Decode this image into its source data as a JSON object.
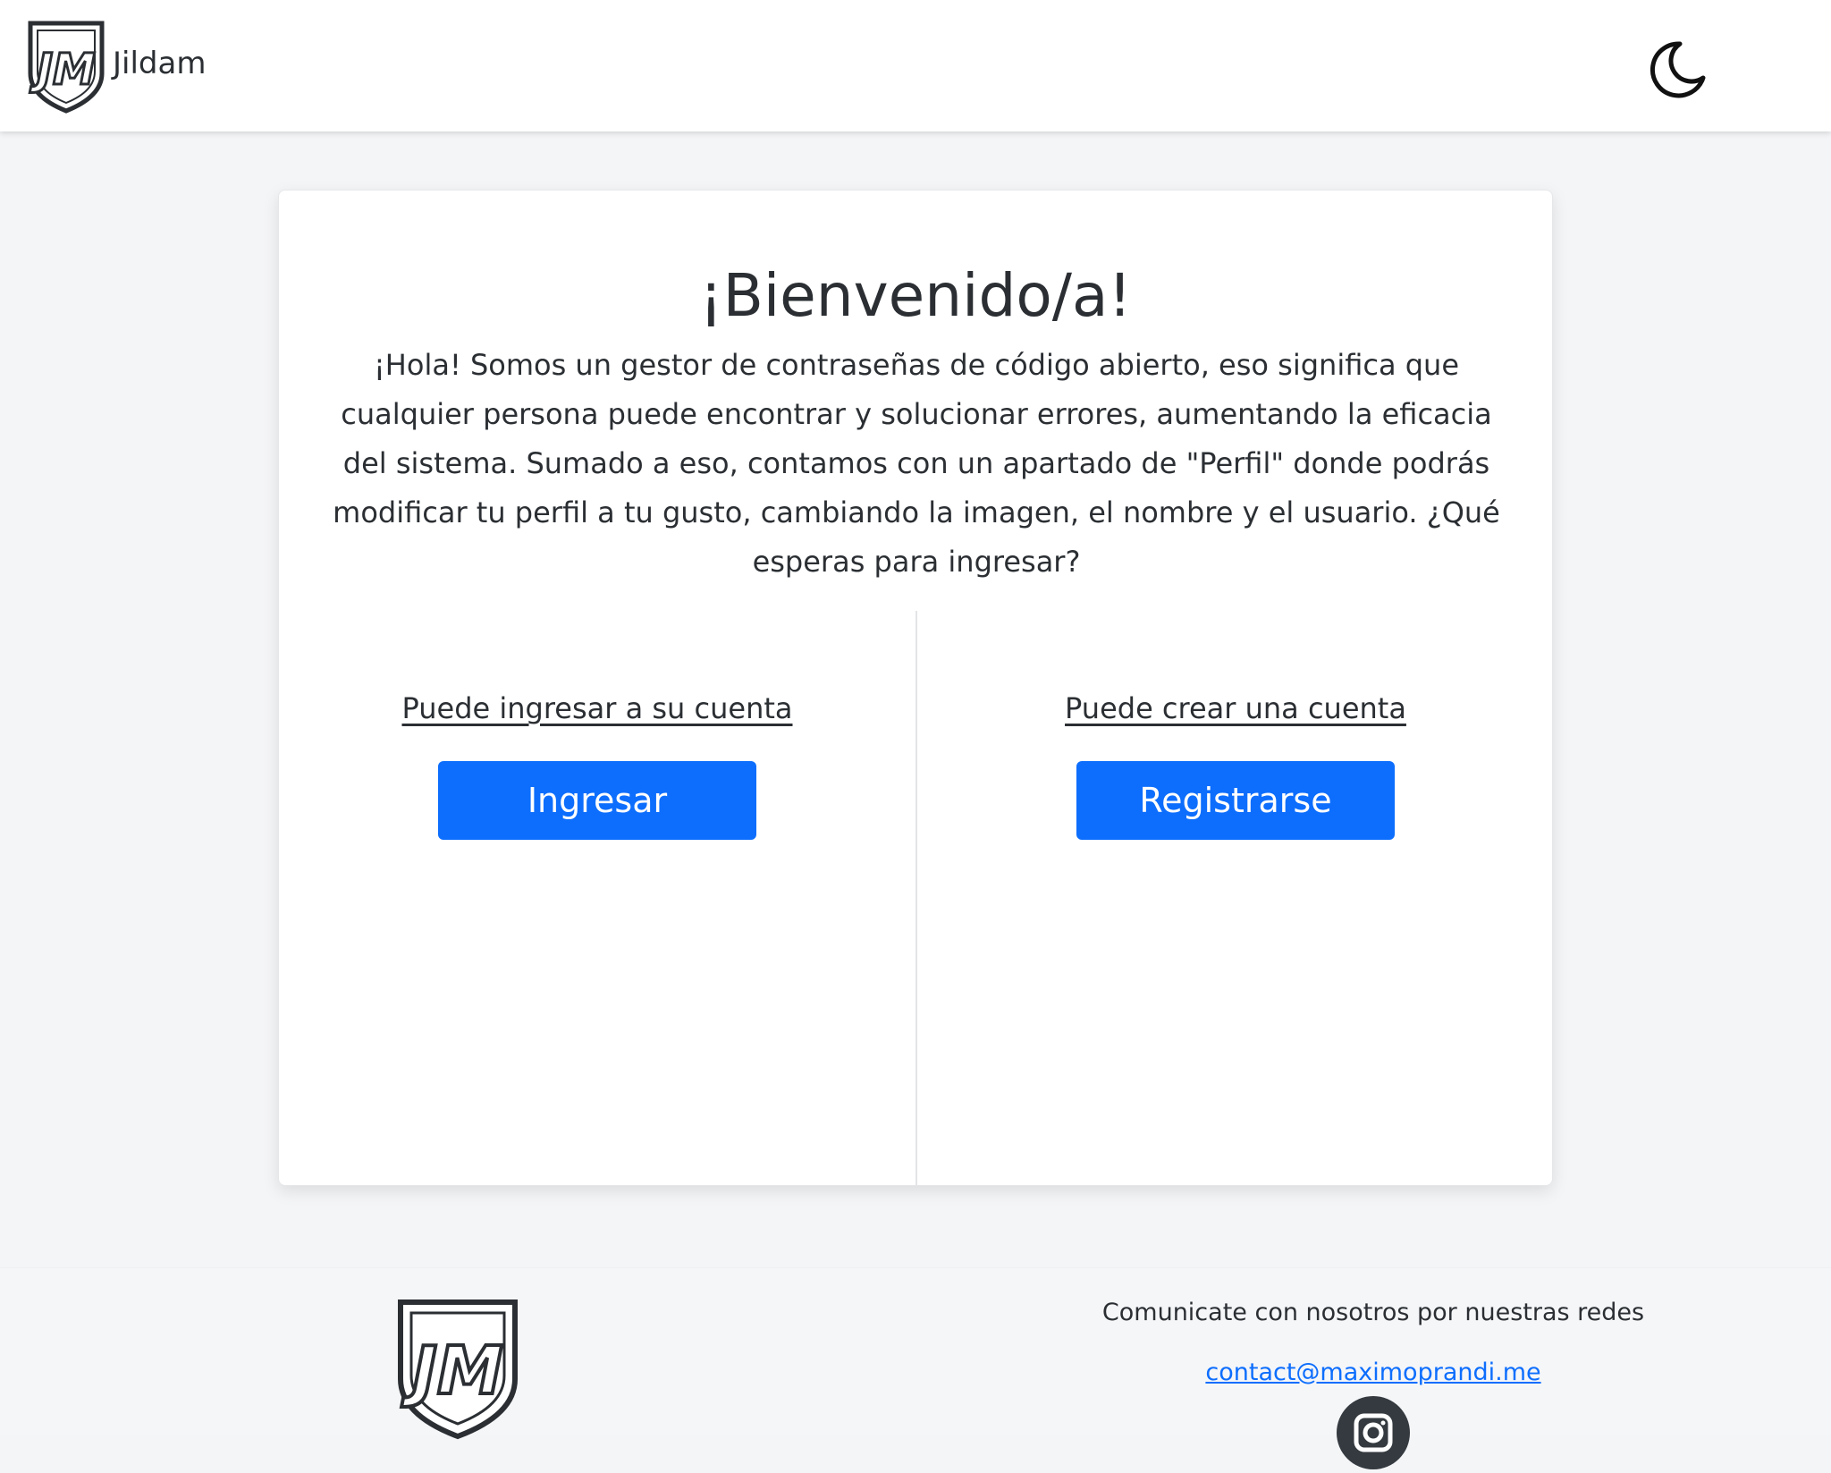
{
  "navbar": {
    "brand_name": "Jildam",
    "logo_letters": "JM",
    "theme_icon": "moon-icon"
  },
  "welcome": {
    "title": "¡Bienvenido/a!",
    "intro": "¡Hola! Somos un gestor de contraseñas de código abierto, eso significa que cualquier persona puede encontrar y solucionar errores, aumentando la eficacia del sistema. Sumado a eso, contamos con un apartado de \"Perfil\" donde podrás modificar tu perfil a tu gusto, cambiando la imagen, el nombre y el usuario. ¿Qué esperas para ingresar?"
  },
  "login": {
    "caption": "Puede ingresar a su cuenta",
    "button_label": "Ingresar"
  },
  "register": {
    "caption": "Puede crear una cuenta",
    "button_label": "Registrarse"
  },
  "footer": {
    "contact_text": "Comunicate con nosotros por nuestras redes",
    "email": "contact@maximoprandi.me",
    "social_icon": "instagram-icon"
  },
  "colors": {
    "primary": "#0d6efd",
    "background": "#f4f5f7",
    "card": "#ffffff",
    "text": "#2b2f33"
  }
}
